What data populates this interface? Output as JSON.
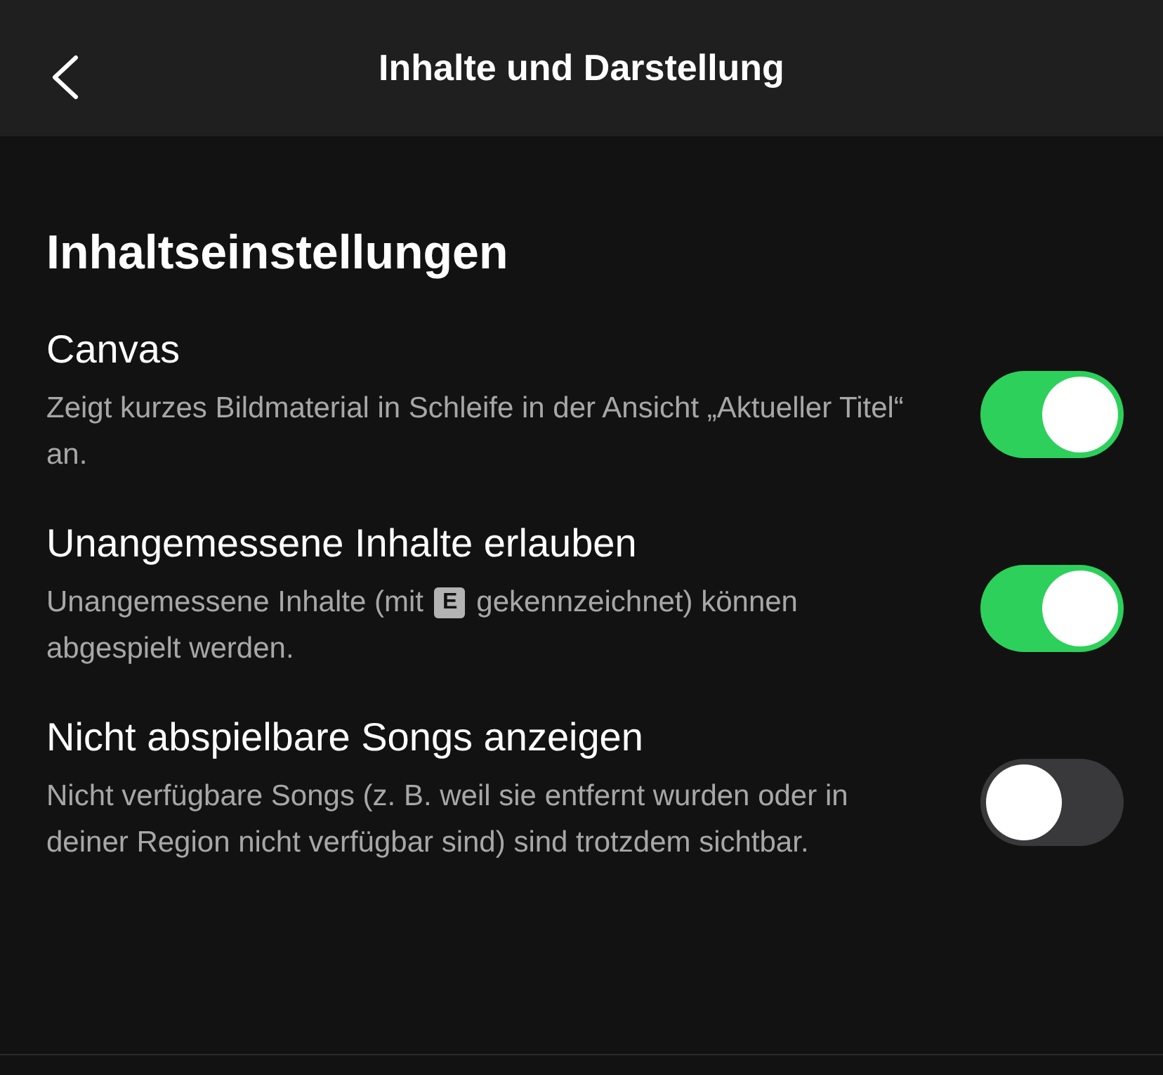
{
  "header": {
    "title": "Inhalte und Darstellung"
  },
  "section": {
    "title": "Inhaltseinstellungen"
  },
  "items": [
    {
      "title": "Canvas",
      "description": [
        {
          "kind": "text",
          "text": "Zeigt kurzes Bildmaterial in Schleife in der Ansicht „Aktueller Titel“ an."
        }
      ],
      "on": true
    },
    {
      "title": "Unangemessene Inhalte erlauben",
      "description": [
        {
          "kind": "text",
          "text": "Unangemessene Inhalte (mit "
        },
        {
          "kind": "badge",
          "text": "E"
        },
        {
          "kind": "text",
          "text": " gekennzeichnet) können abgespielt werden."
        }
      ],
      "on": true
    },
    {
      "title": "Nicht abspielbare Songs anzeigen",
      "description": [
        {
          "kind": "text",
          "text": "Nicht verfügbare Songs (z. B. weil sie entfernt wurden oder in deiner Region nicht verfügbar sind) sind trotzdem sichtbar."
        }
      ],
      "on": false
    }
  ]
}
